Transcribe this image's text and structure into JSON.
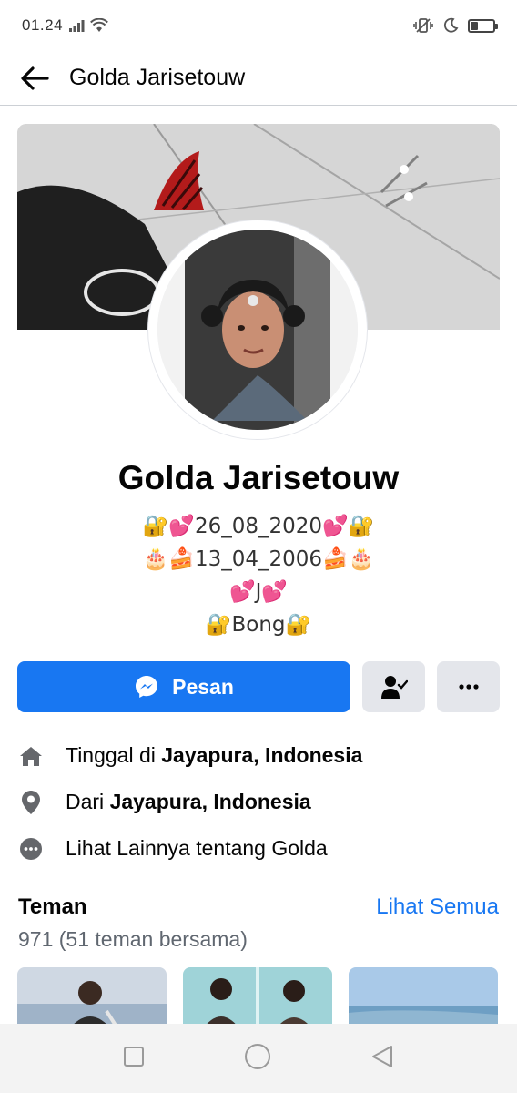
{
  "status_bar": {
    "time": "01.24",
    "signal_icon": "signal-icon",
    "wifi_icon": "wifi-icon",
    "vibrate_icon": "vibrate-icon",
    "moon_icon": "moon-icon",
    "battery_icon": "battery-icon",
    "battery_level": 0.35
  },
  "header": {
    "back_icon": "arrow-left-icon",
    "title": "Golda Jarisetouw"
  },
  "profile": {
    "name": "Golda Jarisetouw",
    "bio_lines": [
      "🔐💕26_08_2020💕🔐",
      "🎂🍰13_04_2006🍰🎂",
      "💕J💕",
      "🔐Bong🔐"
    ]
  },
  "actions": {
    "message_label": "Pesan",
    "message_icon": "messenger-icon",
    "friends_icon": "friend-check-icon",
    "more_icon": "more-icon"
  },
  "info": {
    "items": [
      {
        "icon": "home-icon",
        "prefix": "Tinggal di ",
        "bold": "Jayapura, Indonesia"
      },
      {
        "icon": "location-pin-icon",
        "prefix": "Dari ",
        "bold": "Jayapura, Indonesia"
      },
      {
        "icon": "more-circle-icon",
        "prefix": "Lihat Lainnya tentang Golda",
        "bold": ""
      }
    ]
  },
  "friends": {
    "title": "Teman",
    "see_all": "Lihat Semua",
    "count": "971 (51 teman bersama)"
  },
  "nav": {
    "recents_icon": "square-icon",
    "home_icon": "circle-icon",
    "back_icon": "triangle-back-icon"
  },
  "colors": {
    "accent": "#1877f2",
    "secondary_button": "#e4e6eb",
    "text": "#050505",
    "muted": "#606770"
  }
}
